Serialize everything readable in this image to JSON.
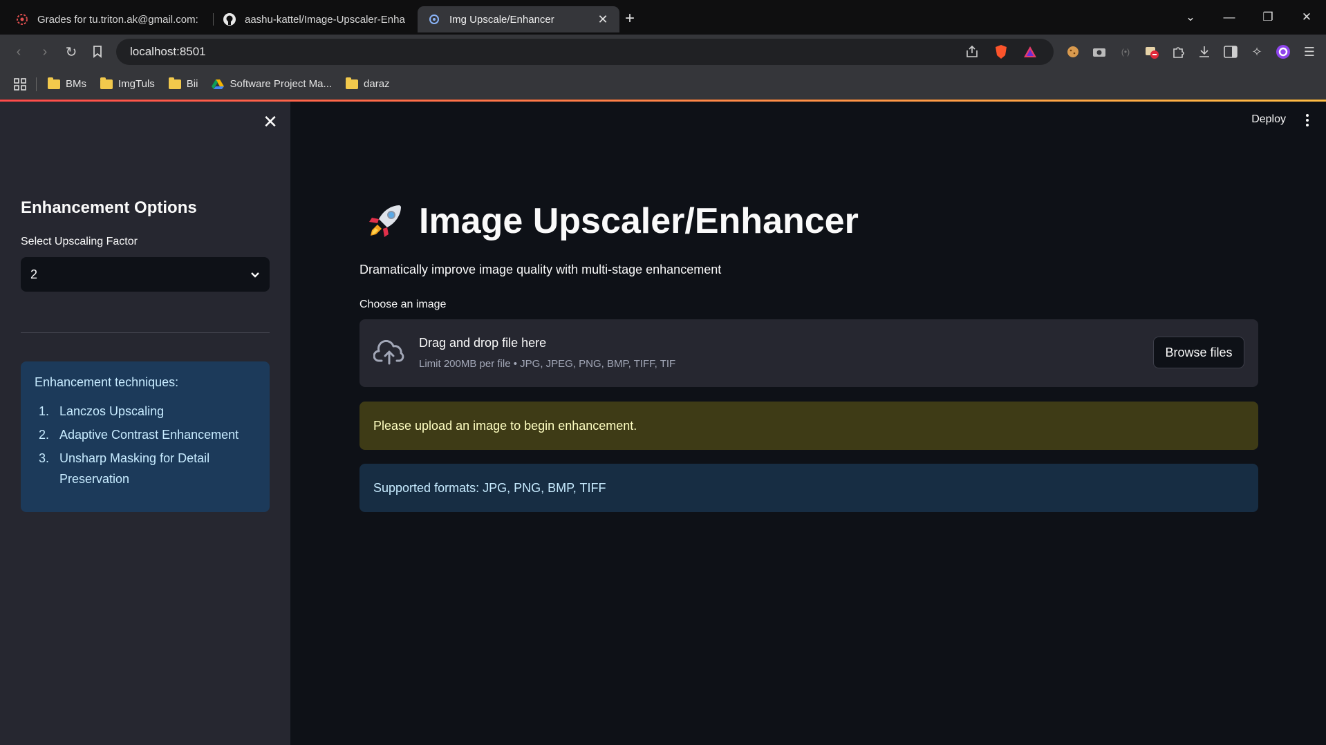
{
  "browser": {
    "tabs": [
      {
        "title": "Grades for tu.triton.ak@gmail.com:",
        "icon": "triton-icon"
      },
      {
        "title": "aashu-kattel/Image-Upscaler-Enhan",
        "icon": "github-icon"
      },
      {
        "title": "Img Upscale/Enhancer",
        "icon": "streamlit-icon",
        "active": true
      }
    ],
    "url": "localhost:8501",
    "bookmarks": [
      {
        "label": "BMs",
        "type": "folder"
      },
      {
        "label": "ImgTuls",
        "type": "folder"
      },
      {
        "label": "Bii",
        "type": "folder"
      },
      {
        "label": "Software Project Ma...",
        "type": "drive"
      },
      {
        "label": "daraz",
        "type": "folder"
      }
    ]
  },
  "sidebar": {
    "heading": "Enhancement Options",
    "select_label": "Select Upscaling Factor",
    "select_value": "2",
    "info_heading": "Enhancement techniques:",
    "techniques": [
      {
        "num": "1.",
        "text": "Lanczos Upscaling"
      },
      {
        "num": "2.",
        "text": "Adaptive Contrast Enhancement"
      },
      {
        "num": "3.",
        "text": "Unsharp Masking for Detail Preservation"
      }
    ]
  },
  "header": {
    "deploy_label": "Deploy"
  },
  "main": {
    "title": "Image Upscaler/Enhancer",
    "subtitle": "Dramatically improve image quality with multi-stage enhancement",
    "uploader_label": "Choose an image",
    "dropzone_title": "Drag and drop file here",
    "dropzone_limit": "Limit 200MB per file • JPG, JPEG, PNG, BMP, TIFF, TIF",
    "browse_label": "Browse files",
    "warning": "Please upload an image to begin enhancement.",
    "info": "Supported formats: JPG, PNG, BMP, TIFF"
  },
  "colors": {
    "app_bg": "#0e1117",
    "sidebar_bg": "#262730",
    "warning_bg": "#3e3b16",
    "info_bg": "#172d43",
    "accent_start": "#ff4b4b",
    "accent_end": "#ffbd45"
  }
}
